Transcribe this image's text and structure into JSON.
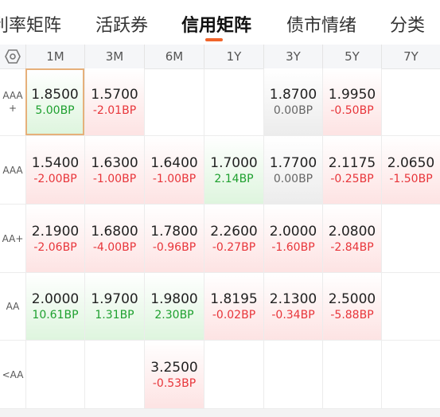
{
  "tabs": [
    {
      "label": "利率矩阵",
      "active": false
    },
    {
      "label": "活跃券",
      "active": false
    },
    {
      "label": "信用矩阵",
      "active": true
    },
    {
      "label": "债市情绪",
      "active": false
    },
    {
      "label": "分类",
      "active": false
    }
  ],
  "colors": {
    "accent": "#f0642a",
    "up": "#e8353a",
    "down": "#1ea02f",
    "flat": "#666666"
  },
  "columns": [
    "1M",
    "3M",
    "6M",
    "1Y",
    "3Y",
    "5Y",
    "7Y"
  ],
  "rows": [
    {
      "label": "AAA\n+",
      "cells": [
        {
          "value": "1.8500",
          "change": "5.00BP",
          "tone": "green",
          "selected": true
        },
        {
          "value": "1.5700",
          "change": "-2.01BP",
          "tone": "red"
        },
        null,
        null,
        {
          "value": "1.8700",
          "change": "0.00BP",
          "tone": "gray"
        },
        {
          "value": "1.9950",
          "change": "-0.50BP",
          "tone": "red"
        },
        null
      ]
    },
    {
      "label": "AAA",
      "cells": [
        {
          "value": "1.5400",
          "change": "-2.00BP",
          "tone": "red"
        },
        {
          "value": "1.6300",
          "change": "-1.00BP",
          "tone": "red"
        },
        {
          "value": "1.6400",
          "change": "-1.00BP",
          "tone": "red"
        },
        {
          "value": "1.7000",
          "change": "2.14BP",
          "tone": "green"
        },
        {
          "value": "1.7700",
          "change": "0.00BP",
          "tone": "gray"
        },
        {
          "value": "2.1175",
          "change": "-0.25BP",
          "tone": "red"
        },
        {
          "value": "2.0650",
          "change": "-1.50BP",
          "tone": "red"
        }
      ]
    },
    {
      "label": "AA+",
      "cells": [
        {
          "value": "2.1900",
          "change": "-2.06BP",
          "tone": "red"
        },
        {
          "value": "1.6800",
          "change": "-4.00BP",
          "tone": "red"
        },
        {
          "value": "1.7800",
          "change": "-0.96BP",
          "tone": "red"
        },
        {
          "value": "2.2600",
          "change": "-0.27BP",
          "tone": "red"
        },
        {
          "value": "2.0000",
          "change": "-1.60BP",
          "tone": "red"
        },
        {
          "value": "2.0800",
          "change": "-2.84BP",
          "tone": "red"
        },
        null
      ]
    },
    {
      "label": "AA",
      "cells": [
        {
          "value": "2.0000",
          "change": "10.61BP",
          "tone": "green"
        },
        {
          "value": "1.9700",
          "change": "1.31BP",
          "tone": "green"
        },
        {
          "value": "1.9800",
          "change": "2.30BP",
          "tone": "green"
        },
        {
          "value": "1.8195",
          "change": "-0.02BP",
          "tone": "red"
        },
        {
          "value": "2.1300",
          "change": "-0.34BP",
          "tone": "red"
        },
        {
          "value": "2.5000",
          "change": "-5.88BP",
          "tone": "red"
        },
        null
      ]
    },
    {
      "label": "<AA",
      "cells": [
        null,
        null,
        {
          "value": "3.2500",
          "change": "-0.53BP",
          "tone": "red"
        },
        null,
        null,
        null,
        null
      ]
    }
  ]
}
